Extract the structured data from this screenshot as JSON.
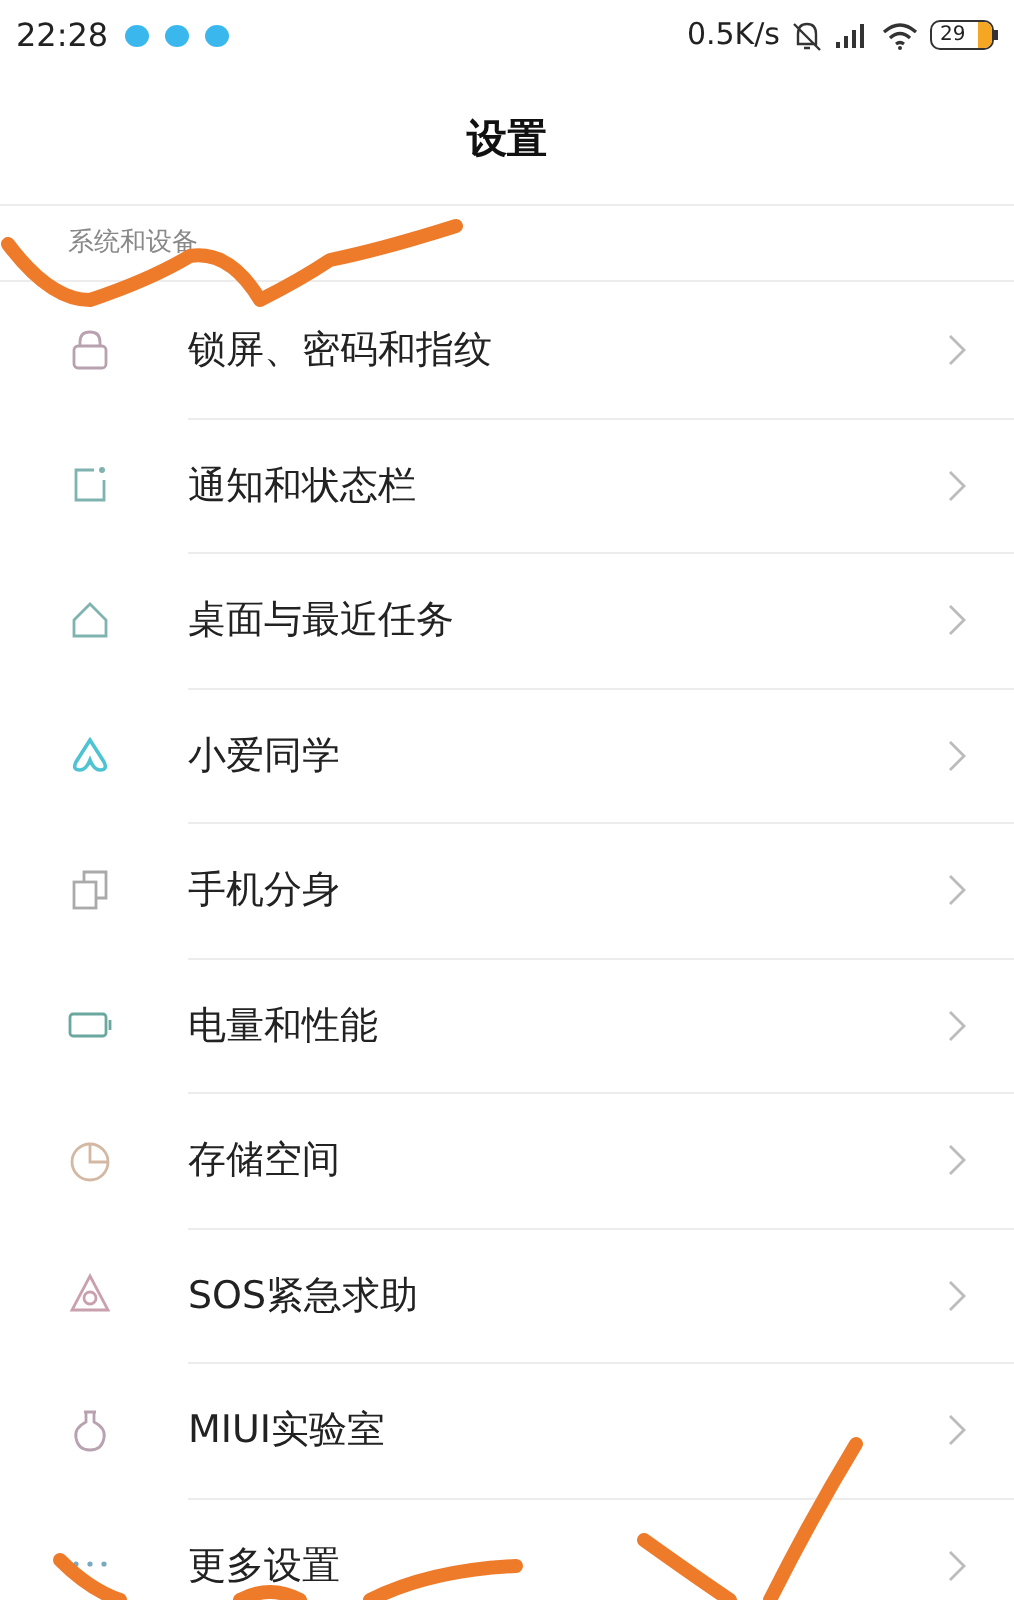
{
  "status_bar": {
    "time": "22:28",
    "network_speed": "0.5K/s",
    "battery": "29"
  },
  "title": "设置",
  "section": {
    "label": "系统和设备",
    "items": [
      {
        "kind": "lock",
        "label": "锁屏、密码和指纹"
      },
      {
        "kind": "notification",
        "label": "通知和状态栏"
      },
      {
        "kind": "home",
        "label": "桌面与最近任务"
      },
      {
        "kind": "assistant",
        "label": "小爱同学"
      },
      {
        "kind": "clone",
        "label": "手机分身"
      },
      {
        "kind": "battery",
        "label": "电量和性能"
      },
      {
        "kind": "storage",
        "label": "存储空间"
      },
      {
        "kind": "sos",
        "label": "SOS紧急求助"
      },
      {
        "kind": "lab",
        "label": "MIUI实验室"
      },
      {
        "kind": "more",
        "label": "更多设置"
      }
    ]
  }
}
